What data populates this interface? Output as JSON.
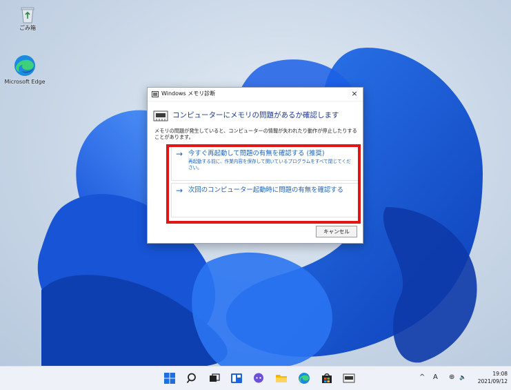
{
  "desktop": {
    "icons": [
      {
        "name": "recycle-bin",
        "label": "ごみ箱"
      },
      {
        "name": "microsoft-edge",
        "label": "Microsoft Edge"
      }
    ]
  },
  "dialog": {
    "title": "Windows メモリ診断",
    "close_glyph": "×",
    "header": "コンピューターにメモリの問題があるか確認します",
    "description": "メモリの問題が発生していると、コンピューターの情報が失われたり動作が停止したりすることがあります。",
    "options": [
      {
        "arrow": "→",
        "title": "今すぐ再起動して問題の有無を確認する (推奨)",
        "subtitle": "再起動する前に、作業内容を保存して開いているプログラムをすべて閉じてください。"
      },
      {
        "arrow": "→",
        "title": "次回のコンピューター起動時に問題の有無を確認する",
        "subtitle": ""
      }
    ],
    "cancel_label": "キャンセル",
    "highlight_color": "#e31414"
  },
  "taskbar": {
    "icons": [
      "start-icon",
      "search-icon",
      "task-view-icon",
      "widgets-icon",
      "chat-icon",
      "file-explorer-icon",
      "edge-icon",
      "store-icon",
      "memory-diagnostic-icon"
    ],
    "tray": {
      "chevron": "^",
      "ime": "A",
      "network_glyph": "⊕",
      "volume_glyph": "🔈",
      "time": "19:08",
      "date": "2021/09/12"
    }
  },
  "colors": {
    "link_blue": "#1e63b8",
    "header_blue": "#1f3a8a",
    "taskbar": "#eef2f8"
  }
}
